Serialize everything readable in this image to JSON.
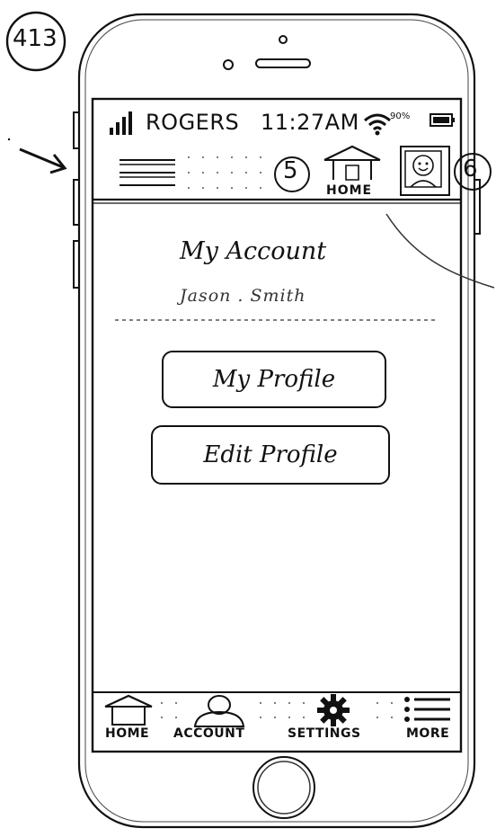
{
  "annotations": {
    "screen_number": "413",
    "callout_home": "5",
    "callout_avatar": "6"
  },
  "status_bar": {
    "carrier": "ROGERS",
    "time": "11:27AM",
    "battery_percent": "90%"
  },
  "header": {
    "menu_icon": "hamburger-icon",
    "home_label": "HOME",
    "avatar_icon": "smiley-avatar-icon"
  },
  "content": {
    "title": "My Account",
    "username": "Jason . Smith",
    "buttons": {
      "my_profile": "My Profile",
      "edit_profile": "Edit Profile"
    }
  },
  "tab_bar": {
    "items": [
      {
        "label": "HOME",
        "icon": "home-icon"
      },
      {
        "label": "ACCOUNT",
        "icon": "person-icon"
      },
      {
        "label": "SETTINGS",
        "icon": "gear-icon"
      },
      {
        "label": "MORE",
        "icon": "list-icon"
      }
    ]
  },
  "colors": {
    "ink": "#111111",
    "paper": "#ffffff"
  }
}
